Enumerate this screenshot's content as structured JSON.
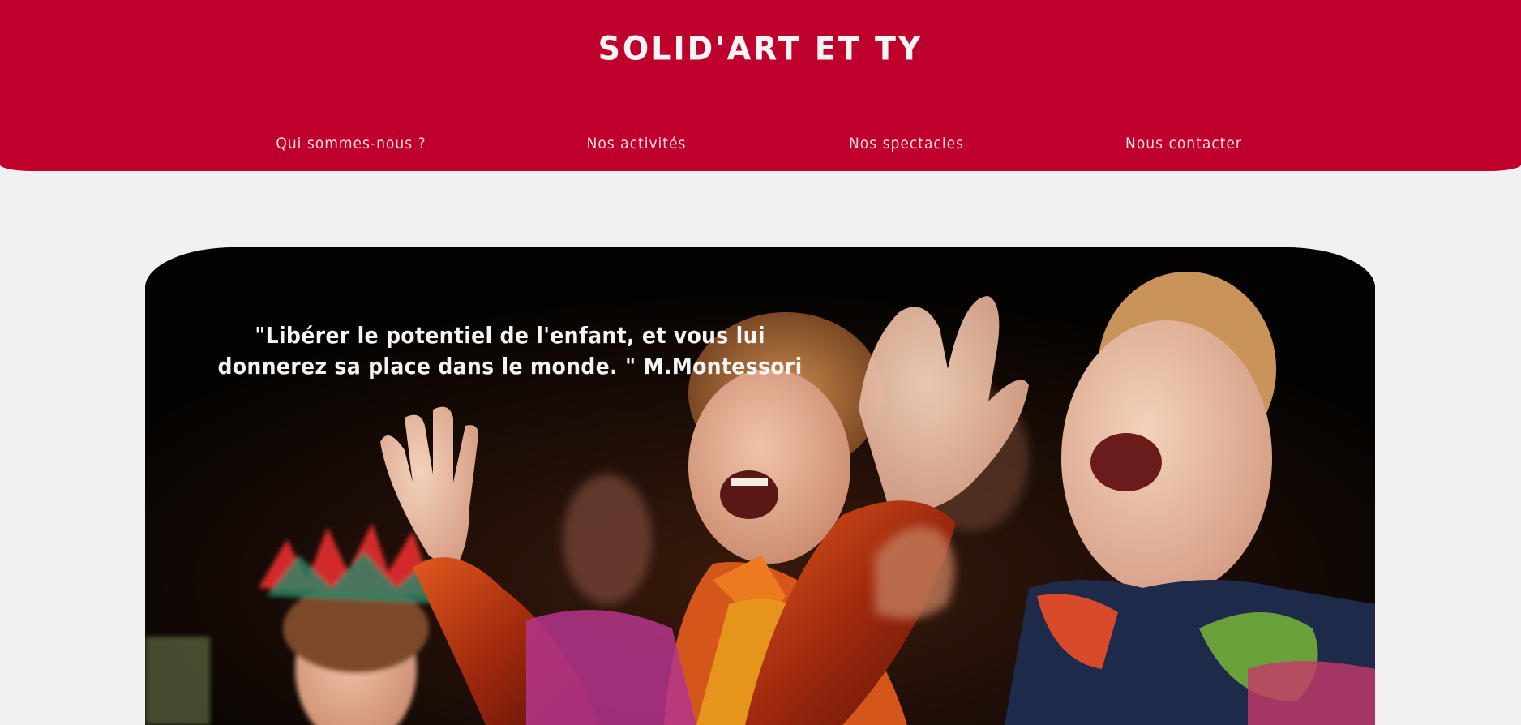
{
  "header": {
    "title": "SOLID'ART ET TY",
    "background_color": "#bf002d"
  },
  "nav": {
    "items": [
      {
        "label": "Qui sommes-nous ?"
      },
      {
        "label": "Nos activités"
      },
      {
        "label": "Nos spectacles"
      },
      {
        "label": "Nous contacter"
      }
    ]
  },
  "hero": {
    "quote": "\"Libérer le potentiel de l'enfant, et vous lui donnerez sa place dans le monde. \" M.Montessori",
    "image_subject": "children in colorful costumes laughing with raised hands on stage"
  },
  "colors": {
    "page_background": "#f1f1f1",
    "accent": "#bf002d"
  }
}
